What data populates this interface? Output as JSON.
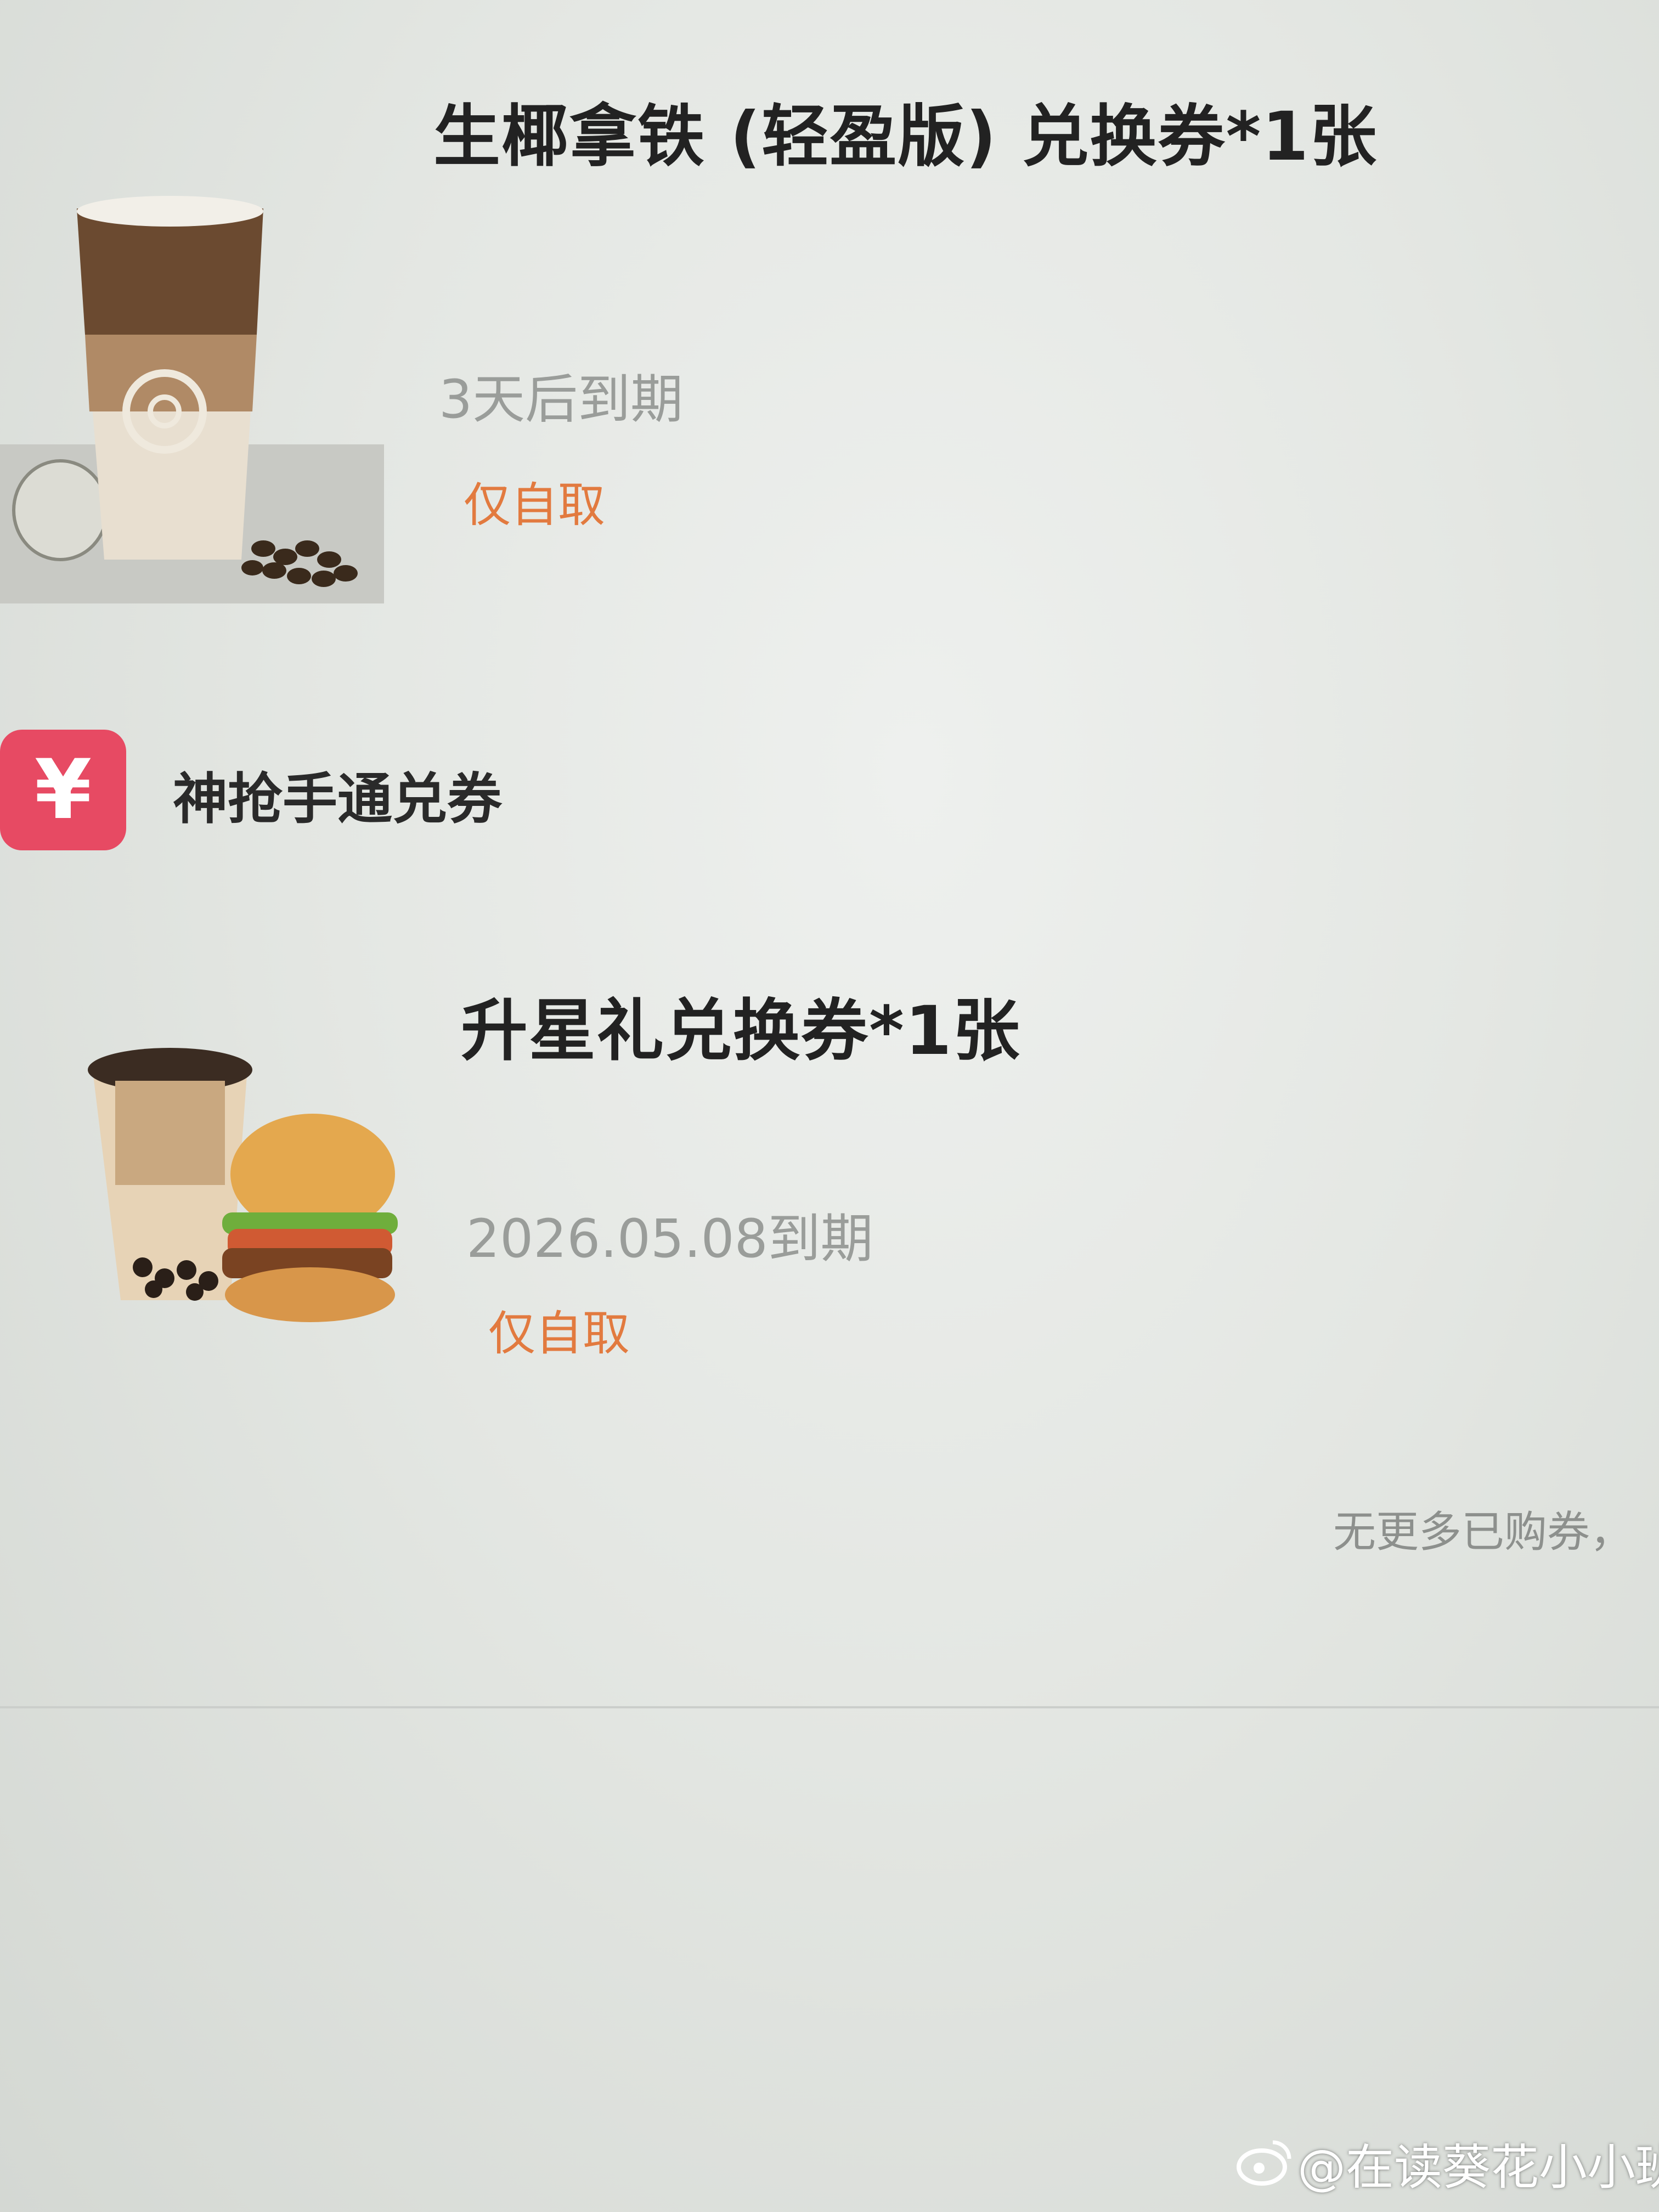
{
  "coupons": [
    {
      "title": "生椰拿铁 (轻盈版) 兑换券*1张",
      "expiry": "3天后到期",
      "tag": "仅自取",
      "image_icon": "iced-latte-image"
    },
    {
      "title": "升星礼兑换券*1张",
      "expiry": "2026.05.08到期",
      "tag": "仅自取",
      "image_icon": "milk-tea-burger-image"
    }
  ],
  "section": {
    "label": "神抢手通兑券",
    "icon_symbol": "¥",
    "icon": "coupon-ticket-icon"
  },
  "footer": {
    "note": "无更多已购券，"
  },
  "watermark": {
    "text": "@在读葵花小小班",
    "icon": "weibo-logo-icon"
  },
  "colors": {
    "tag": "#e27a3f",
    "section_icon_bg": "#e74a63",
    "expiry_text": "#9a9d9a"
  }
}
